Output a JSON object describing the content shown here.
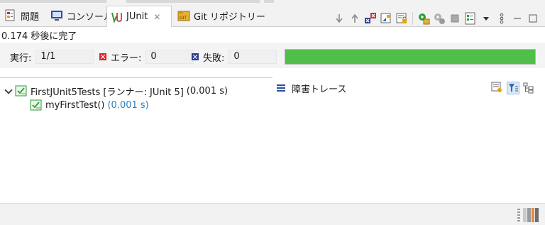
{
  "tabs": [
    {
      "label": "問題",
      "icon": "problems-icon"
    },
    {
      "label": "コンソール",
      "icon": "console-icon"
    },
    {
      "label": "JUnit",
      "icon": "junit-icon",
      "active": true,
      "close": "✕"
    },
    {
      "label": "Git リポジトリー",
      "icon": "git-icon"
    }
  ],
  "toolbar_icons": [
    "next-failure-icon",
    "previous-failure-icon",
    "show-failures-only-icon",
    "scroll-lock-icon",
    "lock-icon",
    "rerun-test-icon",
    "rerun-failed-first-icon",
    "stop-icon",
    "test-history-icon",
    "view-menu-icon",
    "more-icon",
    "minimize-icon",
    "maximize-icon"
  ],
  "status": "0.174 秒後に完了",
  "counters": {
    "runs_label": "実行:",
    "runs_value": "1/1",
    "errors_label": "エラー:",
    "errors_value": "0",
    "failures_label": "失敗:",
    "failures_value": "0",
    "progress_fraction": 1.0,
    "progress_color": "#4fbf4a"
  },
  "tree": {
    "suite": {
      "name": "FirstJUnit5Tests [ランナー: JUnit 5]",
      "time": "(0.001 s)"
    },
    "test": {
      "name": "myFirstTest()",
      "time": "(0.001 s)"
    }
  },
  "failure_trace": {
    "label": "障害トレース"
  },
  "colors": {
    "error_red": "#d8262a",
    "failure_blue": "#2c3e8c",
    "timing_blue": "#2b7fb8",
    "junit_green": "#2e9b3a"
  }
}
